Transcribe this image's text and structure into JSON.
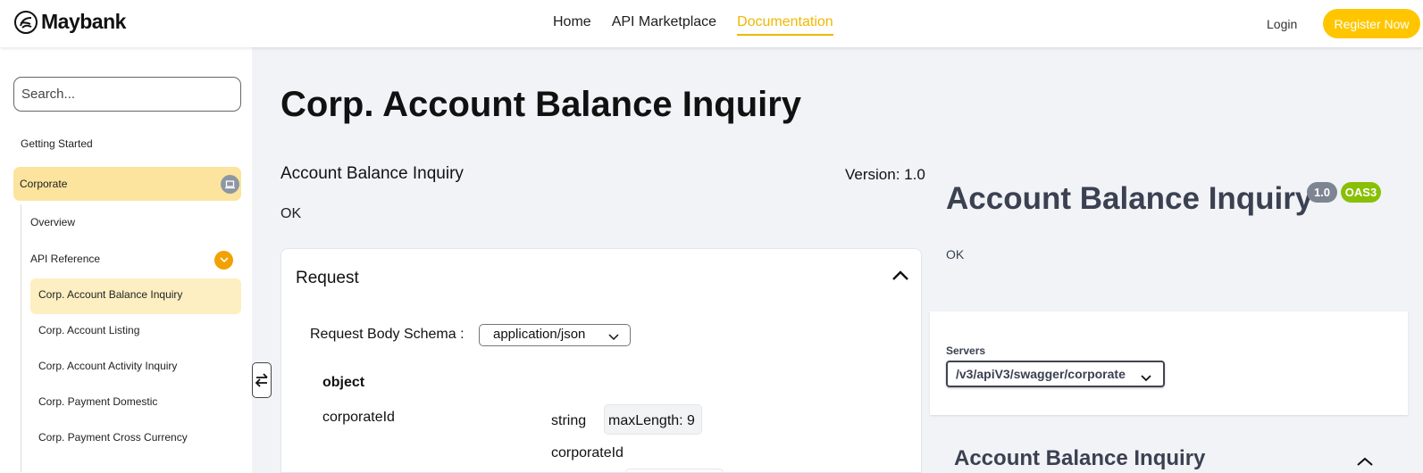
{
  "header": {
    "brand": "Maybank",
    "nav": [
      "Home",
      "API Marketplace",
      "Documentation"
    ],
    "login_label": "Login",
    "register_label": "Register Now"
  },
  "sidebar": {
    "search_placeholder": "Search...",
    "getting_started": "Getting Started",
    "group": "Corporate",
    "overview": "Overview",
    "api_reference": "API Reference",
    "items": [
      "Corp. Account Balance Inquiry",
      "Corp. Account Listing",
      "Corp. Account Activity Inquiry",
      "Corp. Payment Domestic",
      "Corp. Payment Cross Currency"
    ]
  },
  "main": {
    "page_title": "Corp. Account Balance Inquiry",
    "subtitle": "Account Balance Inquiry",
    "version": "Version: 1.0",
    "description": "OK",
    "request": {
      "title": "Request",
      "schema_label": "Request Body Schema :",
      "schema_value": "application/json",
      "object_label": "object",
      "field_name": "corporateId",
      "field_type": "string",
      "field_constraint": "maxLength: 9",
      "field_description": "corporateId"
    }
  },
  "swagger": {
    "title": "Account Balance Inquiry",
    "version_badge": "1.0",
    "oas_badge": "OAS3",
    "description": "OK",
    "servers_label": "Servers",
    "server_value": "/v3/apiV3/swagger/corporate",
    "section_title": "Account Balance Inquiry"
  },
  "colors": {
    "accent": "#ffc600",
    "nav_active": "#f0b800",
    "group_bg": "#fce49e",
    "item_active_bg": "#fdefc2",
    "badge_version": "#7d8492",
    "badge_oas": "#89bf04"
  }
}
